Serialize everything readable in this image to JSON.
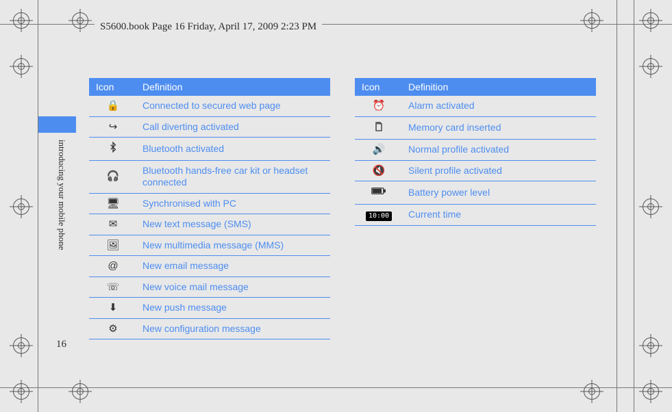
{
  "runhead": "S5600.book  Page 16  Friday, April 17, 2009  2:23 PM",
  "sideLabel": "introducing your mobile phone",
  "pageNumber": "16",
  "header": {
    "icon": "Icon",
    "definition": "Definition"
  },
  "left": [
    {
      "icon": "lock-globe-icon",
      "def": "Connected to secured web page"
    },
    {
      "icon": "divert-arrow-icon",
      "def": "Call diverting activated"
    },
    {
      "icon": "bluetooth-icon",
      "def": "Bluetooth activated"
    },
    {
      "icon": "bluetooth-headset-icon",
      "def": "Bluetooth hands-free car kit or headset connected"
    },
    {
      "icon": "sync-pc-icon",
      "def": "Synchronised with PC"
    },
    {
      "icon": "sms-icon",
      "def": "New text message (SMS)"
    },
    {
      "icon": "mms-icon",
      "def": "New multimedia message (MMS)"
    },
    {
      "icon": "email-icon",
      "def": "New email message"
    },
    {
      "icon": "voicemail-icon",
      "def": "New voice mail message"
    },
    {
      "icon": "push-msg-icon",
      "def": "New push message"
    },
    {
      "icon": "config-msg-icon",
      "def": "New configuration message"
    }
  ],
  "right": [
    {
      "icon": "alarm-icon",
      "def": "Alarm activated"
    },
    {
      "icon": "memory-card-icon",
      "def": "Memory card inserted"
    },
    {
      "icon": "normal-profile-icon",
      "def": "Normal profile activated"
    },
    {
      "icon": "silent-profile-icon",
      "def": "Silent profile activated"
    },
    {
      "icon": "battery-icon",
      "def": "Battery power level"
    },
    {
      "icon": "clock-icon",
      "def": "Current time",
      "glyphText": "10:00"
    }
  ]
}
